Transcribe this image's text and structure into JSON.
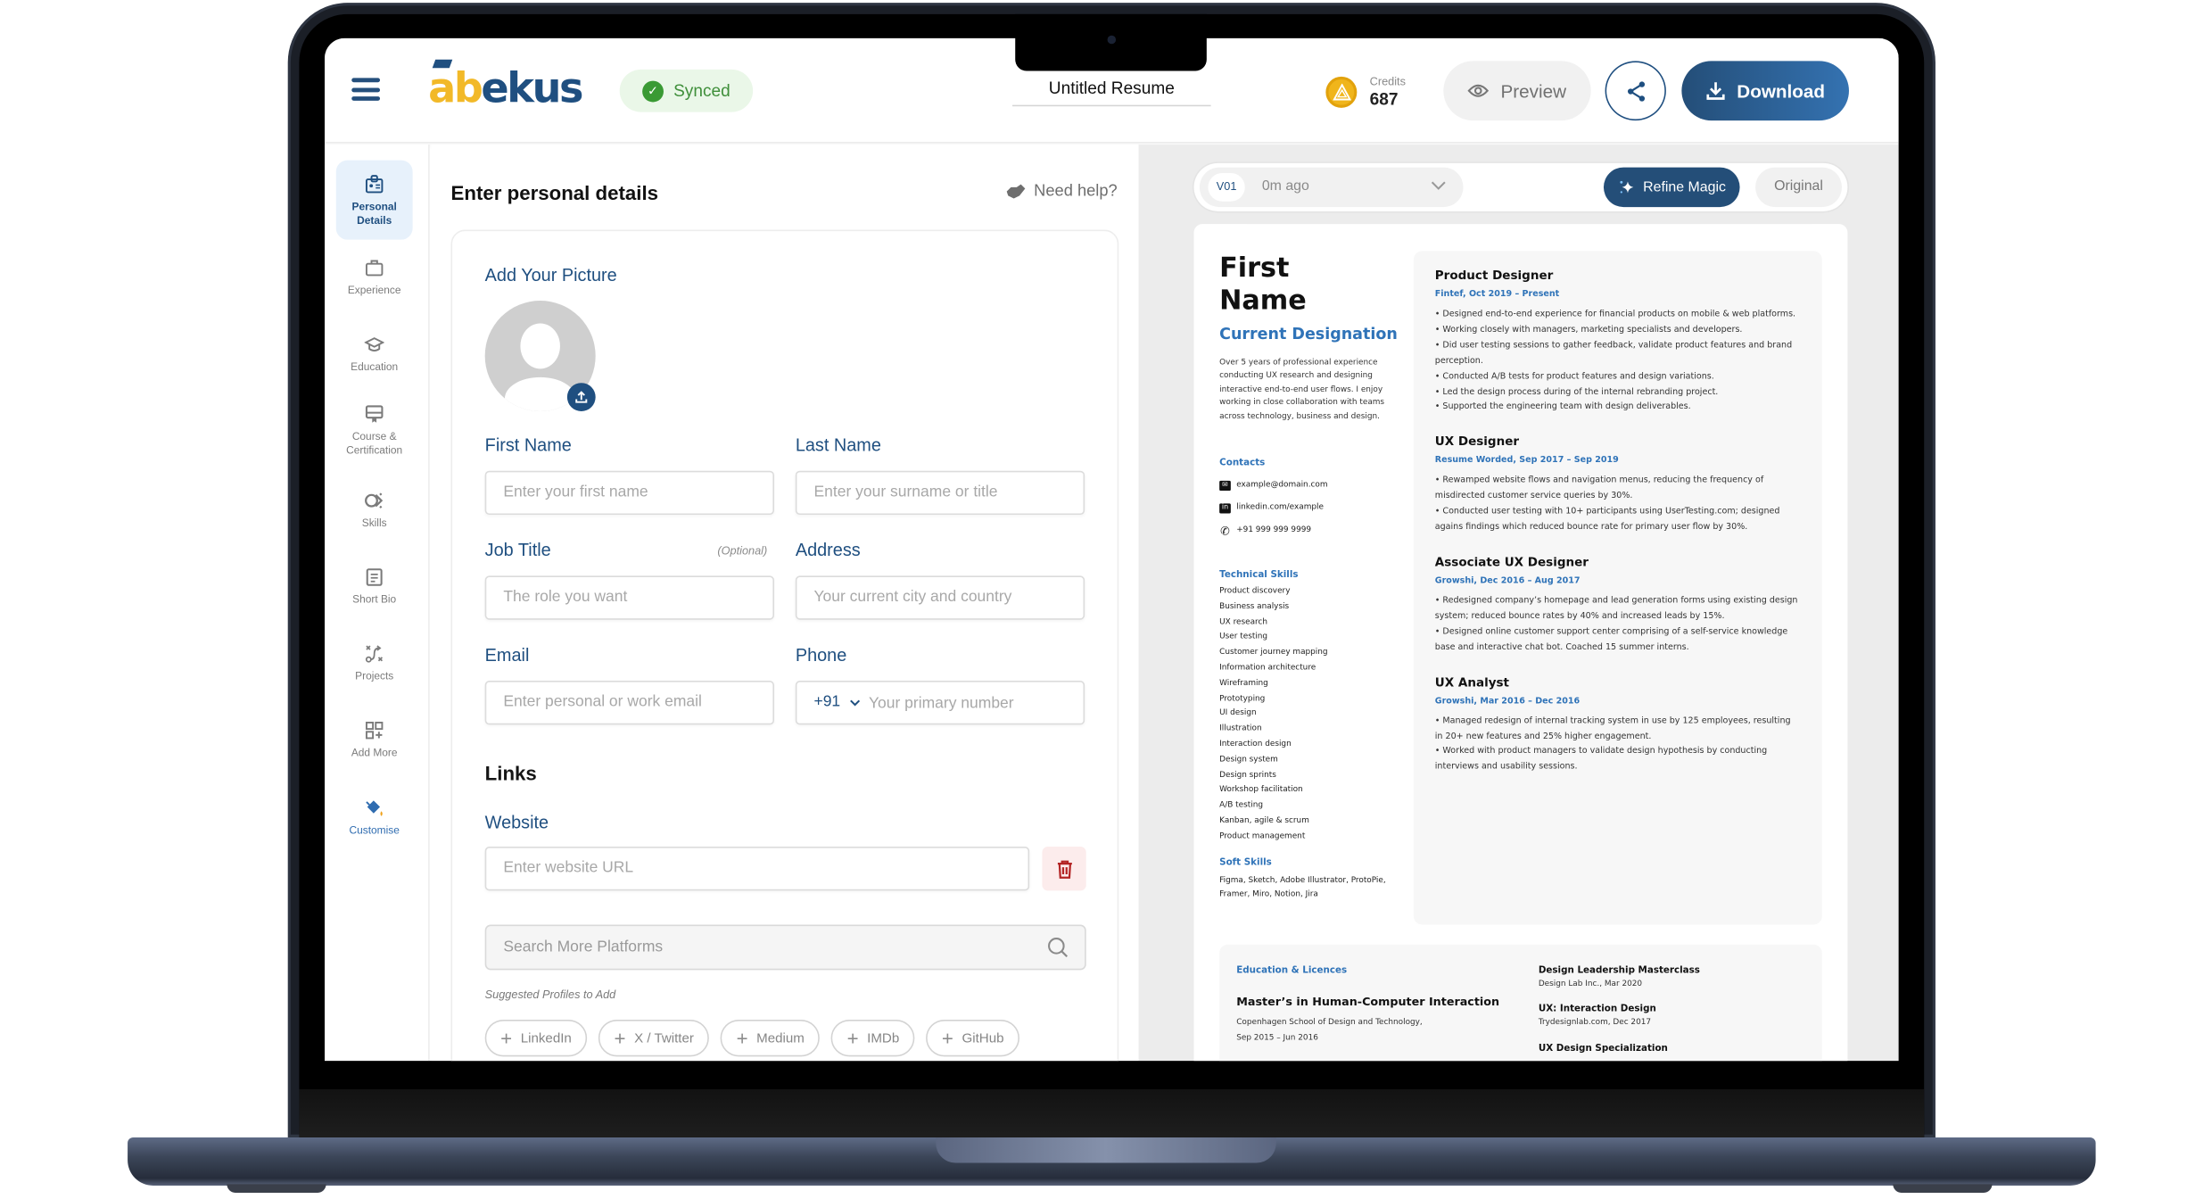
{
  "header": {
    "logo_a": "ab",
    "logo_b": "ekus",
    "sync_status": "Synced",
    "doc_title": "Untitled Resume",
    "credits_label": "Credits",
    "credits_value": "687",
    "preview_label": "Preview",
    "download_label": "Download"
  },
  "sidebar": {
    "items": [
      {
        "label": "Personal Details",
        "icon": "id-badge-icon",
        "active": true
      },
      {
        "label": "Experience",
        "icon": "briefcase-icon"
      },
      {
        "label": "Education",
        "icon": "graduation-cap-icon"
      },
      {
        "label": "Course & Certification",
        "icon": "certificate-icon"
      },
      {
        "label": "Skills",
        "icon": "skills-icon"
      },
      {
        "label": "Short Bio",
        "icon": "document-icon"
      },
      {
        "label": "Projects",
        "icon": "route-icon"
      },
      {
        "label": "Add More",
        "icon": "grid-plus-icon"
      },
      {
        "label": "Customise",
        "icon": "paint-bucket-icon"
      }
    ]
  },
  "form": {
    "title": "Enter personal details",
    "need_help": "Need help?",
    "picture_label": "Add Your Picture",
    "first_name": {
      "label": "First Name",
      "placeholder": "Enter your first name",
      "value": ""
    },
    "last_name": {
      "label": "Last Name",
      "placeholder": "Enter your surname or title",
      "value": ""
    },
    "job_title": {
      "label": "Job Title",
      "optional": "(Optional)",
      "placeholder": "The role you want",
      "value": ""
    },
    "address": {
      "label": "Address",
      "placeholder": "Your current city and country",
      "value": ""
    },
    "email": {
      "label": "Email",
      "placeholder": "Enter personal or work email",
      "value": ""
    },
    "phone": {
      "label": "Phone",
      "country_code": "+91",
      "placeholder": "Your primary number",
      "value": ""
    },
    "links_heading": "Links",
    "website": {
      "label": "Website",
      "placeholder": "Enter website URL",
      "value": ""
    },
    "search_platforms": {
      "placeholder": "Search More Platforms"
    },
    "suggested_label": "Suggested Profiles to Add",
    "suggested": [
      "LinkedIn",
      "X / Twitter",
      "Medium",
      "IMDb",
      "GitHub"
    ]
  },
  "preview": {
    "version_tag": "V01",
    "version_time": "0m ago",
    "refine_label": "Refine Magic",
    "original_label": "Original",
    "resume": {
      "first_name": "First",
      "last_name": "Name",
      "designation": "Current Designation",
      "bio": "Over 5 years of professional experience conducting UX research and designing interactive end-to-end user flows. I enjoy working in close collaboration with teams across technology, business and design.",
      "contacts_heading": "Contacts",
      "email": "example@domain.com",
      "linkedin": "linkedin.com/example",
      "phone": "+91 999 999 9999",
      "tech_skills_heading": "Technical Skills",
      "tech_skills": [
        "Product discovery",
        "Business analysis",
        "UX research",
        "User testing",
        "Customer journey mapping",
        "Information architecture",
        "Wireframing",
        "Prototyping",
        "UI design",
        "Illustration",
        "Interaction design",
        "Design system",
        "Design sprints",
        "Workshop facilitation",
        "A/B testing",
        "Kanban, agile & scrum",
        "Product management"
      ],
      "soft_skills_heading": "Soft Skills",
      "soft_skills": "Figma, Sketch, Adobe Illustrator, ProtoPie, Framer, Miro, Notion, Jira",
      "jobs": [
        {
          "title": "Product Designer",
          "company": "Fintef, Oct 2019 – Present",
          "bullets": "• Designed end-to-end experience for financial products on mobile & web platforms.\n• Working closely with managers, marketing specialists and developers.\n• Did user testing sessions to gather feedback, validate product features and brand perception.\n• Conducted A/B tests for product features and design variations.\n• Led the design process during of the internal rebranding project.\n• Supported the engineering team with design deliverables."
        },
        {
          "title": "UX Designer",
          "company": "Resume Worded, Sep 2017 – Sep 2019",
          "bullets": "• Rewamped website flows and navigation menus, reducing the frequency of misdirected customer service queries by 30%.\n• Conducted user testing with 10+ participants using UserTesting.com; designed agains findings which reduced bounce rate for primary user flow by 30%."
        },
        {
          "title": "Associate UX Designer",
          "company": "Growshi, Dec 2016 – Aug 2017",
          "bullets": "• Redesigned company’s homepage and lead generation forms using existing design system; reduced bounce rates by 40% and increased leads by 15%.\n• Designed online customer support center comprising of a self-service knowledge base and interactive chat bot. Coached 15 summer interns."
        },
        {
          "title": "UX Analyst",
          "company": "Growshi, Mar 2016 – Dec 2016",
          "bullets": "• Managed redesign of internal tracking system in use by 125 employees, resulting in 20+ new features and 25% higher engagement.\n• Worked with product managers to validate design hypothesis by conducting interviews and usability sessions."
        }
      ],
      "education_heading": "Education & Licences",
      "degree": "Master’s in Human-Computer Interaction",
      "school": "Copenhagen School of Design and Technology,",
      "school_dates": "Sep 2015 – Jun 2016",
      "certs": [
        {
          "title": "Design Leadership Masterclass",
          "sub": "Design Lab Inc., Mar 2020"
        },
        {
          "title": "UX: Interaction Design",
          "sub": "Trydesignlab.com, Dec 2017"
        },
        {
          "title": "UX Design Specialization",
          "sub": ""
        }
      ]
    }
  },
  "colors": {
    "brand_blue": "#1f4f80",
    "brand_yellow": "#f2b928",
    "accent_blue": "#2f73b8",
    "synced_green": "#3f8f3a",
    "delete_red": "#b32424"
  }
}
